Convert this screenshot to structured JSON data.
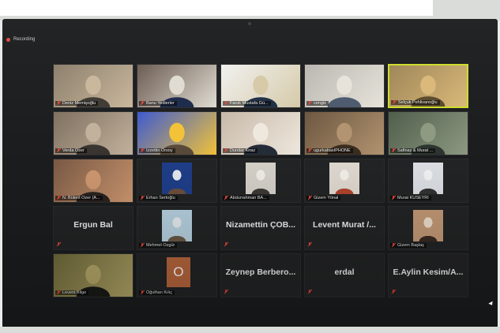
{
  "recording": {
    "label": "Recording"
  },
  "colors": {
    "accent_active_border": "#cddc2b",
    "muted_icon": "#e2463b",
    "tile_bg": "#232425"
  },
  "participants": [
    {
      "name": "Deniz Memişoğlu",
      "type": "video"
    },
    {
      "name": "Banu Yedierler",
      "type": "video"
    },
    {
      "name": "Faruk Mustafa Gü...",
      "type": "video"
    },
    {
      "name": "cengiz",
      "type": "video"
    },
    {
      "name": "Selçuk Pehlivanoğlu",
      "type": "video",
      "active_speaker": true
    },
    {
      "name": "Verda Özer",
      "type": "video"
    },
    {
      "name": "İzzettin Orsoy",
      "type": "video"
    },
    {
      "name": "Dundar Kiraz",
      "type": "video"
    },
    {
      "name": "ugurkabasIPHONE",
      "type": "video"
    },
    {
      "name": "Safinaz & Murat ...",
      "type": "video"
    },
    {
      "name": "N. Bülent Özer (A...",
      "type": "video"
    },
    {
      "name": "Erhan Sertoğlu",
      "type": "profile"
    },
    {
      "name": "Abdurrahman BA...",
      "type": "profile"
    },
    {
      "name": "Gizem Yönal",
      "type": "profile"
    },
    {
      "name": "Murat KUSEYRİ",
      "type": "profile"
    },
    {
      "name": "Ergun Bal",
      "type": "text"
    },
    {
      "name": "Mehmet Özgür",
      "type": "profile"
    },
    {
      "name": "Nizamettin ÇOB...",
      "type": "text"
    },
    {
      "name": "Levent Murat /...",
      "type": "text"
    },
    {
      "name": "Gizem Başlaş",
      "type": "profile"
    },
    {
      "name": "Levent Bilge",
      "type": "video"
    },
    {
      "name": "Oğulhan Kılıç",
      "type": "initial",
      "initial": "O"
    },
    {
      "name": "Zeynep Berbero...",
      "type": "text"
    },
    {
      "name": "erdal",
      "type": "text"
    },
    {
      "name": "E.Aylin Kesim/A...",
      "type": "text"
    }
  ]
}
